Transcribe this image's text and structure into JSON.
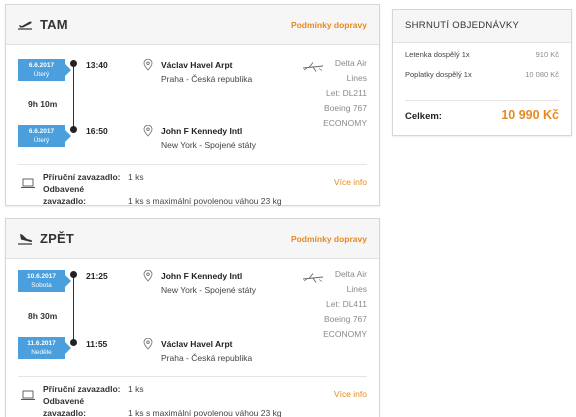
{
  "outbound": {
    "title": "TAM",
    "conditions_link": "Podmínky dopravy",
    "departure": {
      "date": "6.6.2017",
      "weekday": "Úterý",
      "time": "13:40",
      "airport": "Václav Havel Arpt",
      "city": "Praha - Česká republika"
    },
    "duration": "9h 10m",
    "arrival": {
      "date": "6.6.2017",
      "weekday": "Úterý",
      "time": "16:50",
      "airport": "John F Kennedy Intl",
      "city": "New York - Spojené státy"
    },
    "carrier": {
      "airline_line1": "Delta Air",
      "airline_line2": "Lines",
      "flight": "Let: DL211",
      "aircraft": "Boeing 767",
      "cabin": "ECONOMY"
    },
    "baggage": {
      "hand_label": "Příruční zavazadlo:",
      "hand_value": "1 ks",
      "checked_label": "Odbavené zavazadlo:",
      "checked_value": "1 ks s maximální povolenou váhou 23 kg",
      "more_link": "Více info"
    }
  },
  "return": {
    "title": "ZPĚT",
    "conditions_link": "Podmínky dopravy",
    "departure": {
      "date": "10.6.2017",
      "weekday": "Sobota",
      "time": "21:25",
      "airport": "John F Kennedy Intl",
      "city": "New York - Spojené státy"
    },
    "duration": "8h 30m",
    "arrival": {
      "date": "11.6.2017",
      "weekday": "Neděle",
      "time": "11:55",
      "airport": "Václav Havel Arpt",
      "city": "Praha - Česká republika"
    },
    "carrier": {
      "airline_line1": "Delta Air",
      "airline_line2": "Lines",
      "flight": "Let: DL411",
      "aircraft": "Boeing 767",
      "cabin": "ECONOMY"
    },
    "baggage": {
      "hand_label": "Příruční zavazadlo:",
      "hand_value": "1 ks",
      "checked_label": "Odbavené zavazadlo:",
      "checked_value": "1 ks s maximální povolenou váhou 23 kg",
      "more_link": "Více info"
    }
  },
  "summary": {
    "title": "SHRNUTÍ OBJEDNÁVKY",
    "rows": [
      {
        "label": "Letenka dospělý 1x",
        "value": "910 Kč"
      },
      {
        "label": "Poplatky dospělý 1x",
        "value": "10 080 Kč"
      }
    ],
    "total_label": "Celkem:",
    "total_value": "10 990 Kč"
  },
  "icons": {
    "outbound": "plane-takeoff-icon",
    "return": "plane-landing-icon",
    "location": "map-pin-icon",
    "airline": "airline-logo-icon",
    "baggage": "suitcase-icon"
  },
  "colors": {
    "accent": "#e8891d",
    "date_badge": "#4a9fdc"
  }
}
